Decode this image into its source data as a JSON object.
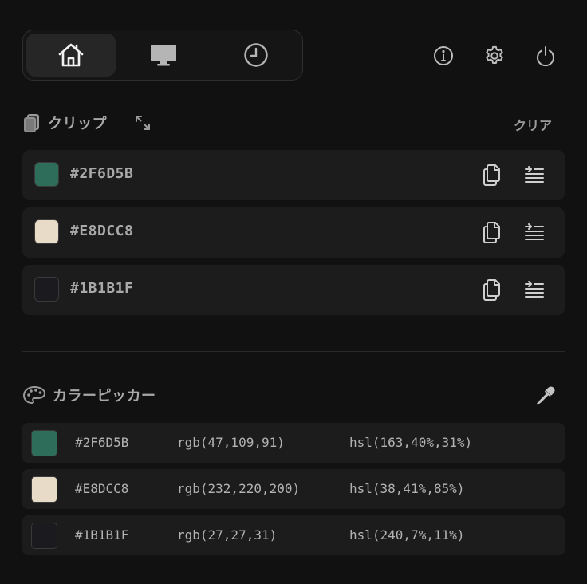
{
  "nav": {
    "tabs": [
      {
        "icon": "home-icon",
        "active": true
      },
      {
        "icon": "monitor-icon",
        "active": false
      },
      {
        "icon": "clock-icon",
        "active": false
      }
    ],
    "actions": [
      "info-icon",
      "gear-icon",
      "power-icon"
    ]
  },
  "clip": {
    "title": "クリップ",
    "clear_label": "クリア",
    "items": [
      {
        "hex": "#2F6D5B",
        "swatch": "#2F6D5B"
      },
      {
        "hex": "#E8DCC8",
        "swatch": "#E8DCC8"
      },
      {
        "hex": "#1B1B1F",
        "swatch": "#1B1B1F"
      }
    ]
  },
  "picker": {
    "title": "カラーピッカー",
    "items": [
      {
        "hex": "#2F6D5B",
        "rgb": "rgb(47,109,91)",
        "hsl": "hsl(163,40%,31%)",
        "swatch": "#2F6D5B"
      },
      {
        "hex": "#E8DCC8",
        "rgb": "rgb(232,220,200)",
        "hsl": "hsl(38,41%,85%)",
        "swatch": "#E8DCC8"
      },
      {
        "hex": "#1B1B1F",
        "rgb": "rgb(27,27,31)",
        "hsl": "hsl(240,7%,11%)",
        "swatch": "#1B1B1F"
      }
    ]
  },
  "colors": {
    "background": "#111111",
    "row": "#1c1c1c",
    "active_tab": "#262626",
    "icon": "#c8c8c8",
    "text": "#a9a9a9"
  }
}
